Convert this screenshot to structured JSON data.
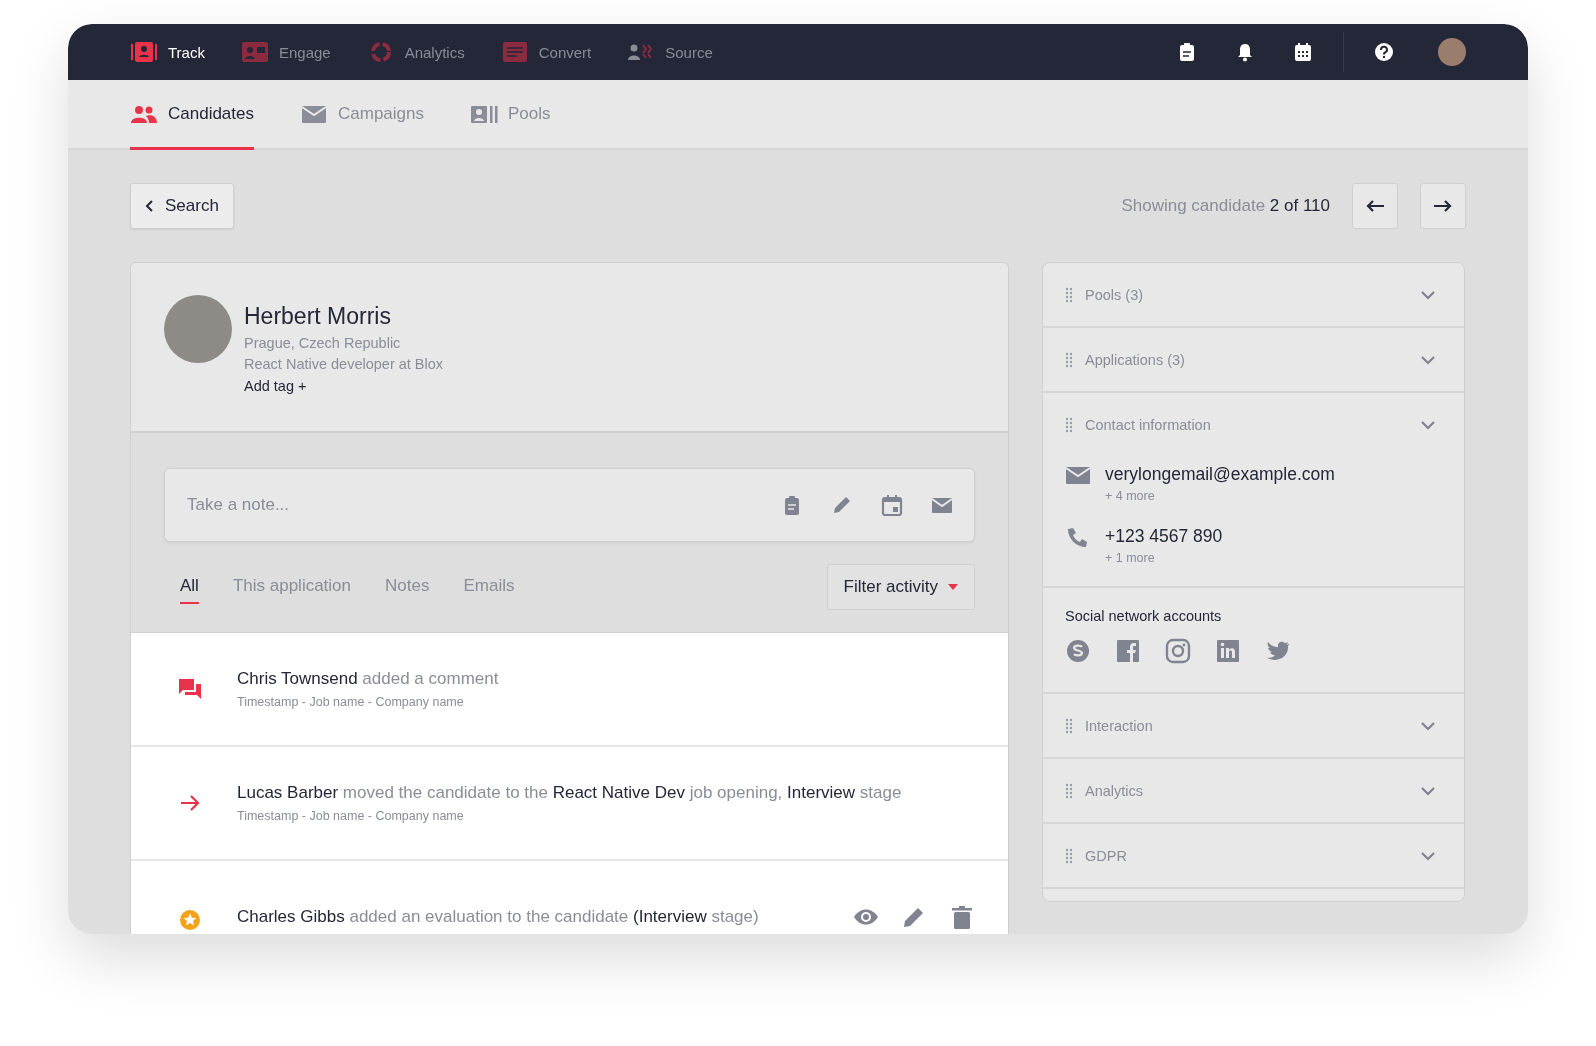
{
  "top_nav": [
    {
      "kind": "track",
      "label": "Track",
      "selected": true
    },
    {
      "kind": "engage",
      "label": "Engage",
      "selected": false
    },
    {
      "kind": "analytics",
      "label": "Analytics",
      "selected": false
    },
    {
      "kind": "convert",
      "label": "Convert",
      "selected": false
    },
    {
      "kind": "source",
      "label": "Source",
      "selected": false
    }
  ],
  "top_actions": [
    {
      "kind": "clipboard"
    },
    {
      "kind": "bell"
    },
    {
      "kind": "calendar"
    },
    {
      "kind": "help"
    }
  ],
  "sub_tabs": [
    {
      "kind": "people",
      "label": "Candidates",
      "selected": true
    },
    {
      "kind": "mail",
      "label": "Campaigns",
      "selected": false
    },
    {
      "kind": "pools",
      "label": "Pools",
      "selected": false
    }
  ],
  "back_button": "Search",
  "pager": {
    "text": "Showing candidate **2 of 110**"
  },
  "candidate": {
    "name": "Herbert Morris",
    "location": "Prague, Czech Republic",
    "position": "React Native developer at Blox",
    "add_tag": "Add tag +"
  },
  "note": {
    "placeholder": "Take a note...",
    "actions": [
      {
        "kind": "clipboard"
      },
      {
        "kind": "pencil"
      },
      {
        "kind": "calendar"
      },
      {
        "kind": "mail"
      }
    ]
  },
  "activity_tabs": [
    {
      "label": "All",
      "selected": true
    },
    {
      "label": "This application",
      "selected": false
    },
    {
      "label": "Notes",
      "selected": false
    },
    {
      "label": "Emails",
      "selected": false
    }
  ],
  "filter_button": "Filter activity",
  "activities": [
    {
      "kind": "comment",
      "text": "**Chris Townsend** added a comment",
      "meta": "Timestamp -  Job name - Company name"
    },
    {
      "kind": "move",
      "text": "**Lucas Barber** moved the candidate to the **React Native Dev** job opening, **Interview** stage",
      "meta": "Timestamp -  Job name - Company name"
    },
    {
      "kind": "evaluation",
      "text": "**Charles Gibbs** added an evaluation to the candidate **(Interview** stage)",
      "actions": [
        {
          "kind": "eye"
        },
        {
          "kind": "pencil"
        },
        {
          "kind": "trash"
        }
      ]
    }
  ],
  "side_sections": [
    {
      "kind": "collapsible",
      "title": "Pools (3)"
    },
    {
      "kind": "collapsible",
      "title": "Applications (3)"
    },
    {
      "kind": "contact",
      "title": "Contact information",
      "contacts": [
        {
          "kind": "email",
          "value": "verylongemail@example.com",
          "more": "+ 4 more"
        },
        {
          "kind": "phone",
          "value": "+123 4567 890",
          "more": "+ 1 more"
        }
      ]
    },
    {
      "kind": "social",
      "title": "Social network accounts",
      "networks": [
        {
          "kind": "skype"
        },
        {
          "kind": "facebook"
        },
        {
          "kind": "instagram"
        },
        {
          "kind": "linkedin"
        },
        {
          "kind": "twitter"
        }
      ]
    },
    {
      "kind": "collapsible",
      "title": "Interaction"
    },
    {
      "kind": "collapsible",
      "title": "Analytics"
    },
    {
      "kind": "collapsible",
      "title": "GDPR"
    }
  ]
}
